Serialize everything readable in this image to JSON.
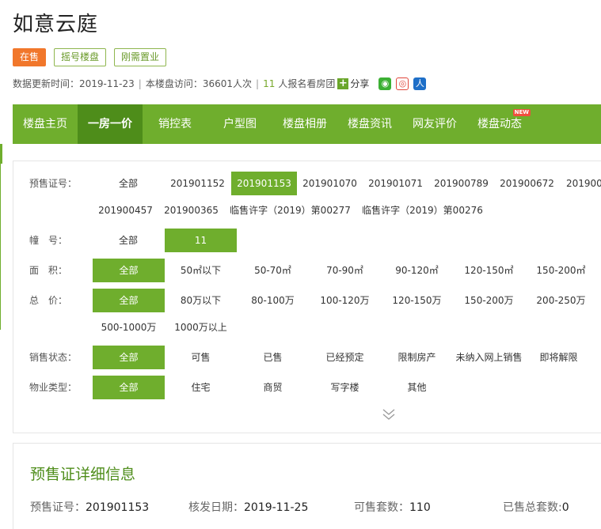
{
  "title": "如意云庭",
  "tags": {
    "sale": "在售",
    "t1": "摇号楼盘",
    "t2": "刚需置业"
  },
  "info": {
    "update_label": "数据更新时间：",
    "update_date": "2019-11-23",
    "visit_label": "本楼盘访问：",
    "visit_count": "36601人次",
    "signup_count": "11",
    "signup_text": "人报名看房团",
    "share": "分享"
  },
  "nav": {
    "items": [
      "楼盘主页",
      "一房一价",
      "销控表",
      "户型图",
      "楼盘相册",
      "楼盘资讯",
      "网友评价",
      "楼盘动态"
    ],
    "new_badge": "NEW"
  },
  "filters": {
    "license_label": "预售证号：",
    "license_opts": [
      "全部",
      "201901152",
      "201901153",
      "201901070",
      "201901071",
      "201900789",
      "201900672",
      "201900",
      "201900457",
      "201900365",
      "临售许字（2019）第00277",
      "临售许字（2019）第00276"
    ],
    "building_label": "幢　号：",
    "building_opts": [
      "全部",
      "11"
    ],
    "area_label": "面　积：",
    "area_opts": [
      "全部",
      "50㎡以下",
      "50-70㎡",
      "70-90㎡",
      "90-120㎡",
      "120-150㎡",
      "150-200㎡"
    ],
    "price_label": "总　价：",
    "price_opts": [
      "全部",
      "80万以下",
      "80-100万",
      "100-120万",
      "120-150万",
      "150-200万",
      "200-250万",
      "500-1000万",
      "1000万以上"
    ],
    "status_label": "销售状态：",
    "status_opts": [
      "全部",
      "可售",
      "已售",
      "已经预定",
      "限制房产",
      "未纳入网上销售",
      "即将解限"
    ],
    "type_label": "物业类型：",
    "type_opts": [
      "全部",
      "住宅",
      "商贸",
      "写字楼",
      "其他"
    ]
  },
  "detail": {
    "title": "预售证详细信息",
    "license_label": "预售证号：",
    "license_value": "201901153",
    "date_label": "核发日期：",
    "date_value": "2019-11-25",
    "avail_label": "可售套数：",
    "avail_value": "110",
    "sold_label": "已售总套数:",
    "sold_value": "0"
  },
  "colors": {
    "green": "#6fae2d",
    "dark_green": "#4e8d1a",
    "orange": "#f1772b"
  }
}
